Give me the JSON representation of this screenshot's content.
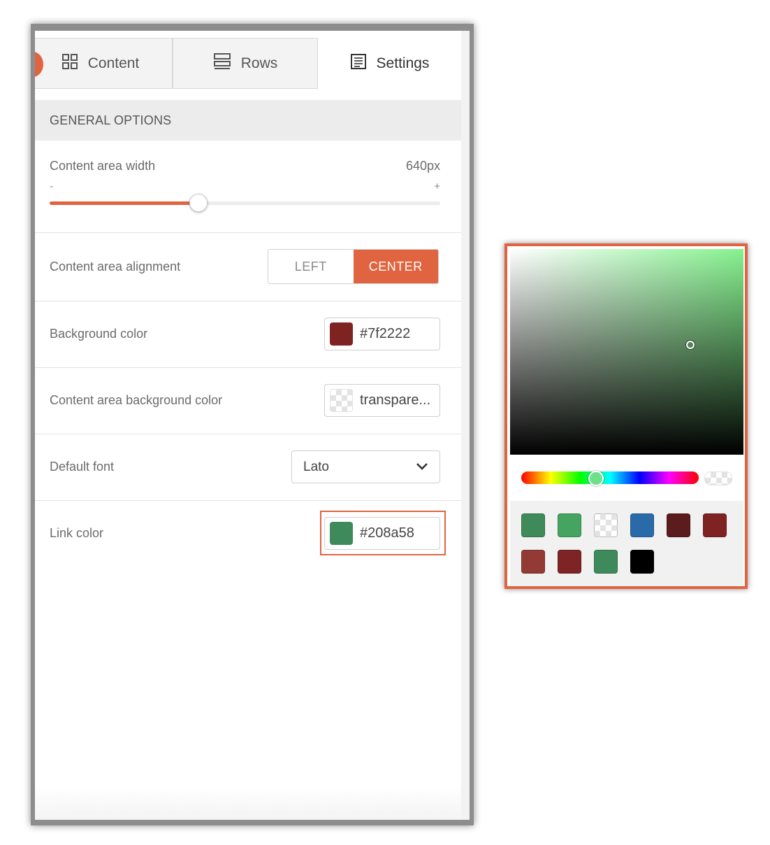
{
  "tabs": [
    {
      "label": "Content",
      "icon": "grid-icon"
    },
    {
      "label": "Rows",
      "icon": "rows-icon"
    },
    {
      "label": "Settings",
      "icon": "settings-doc-icon",
      "active": true
    }
  ],
  "section": {
    "title": "GENERAL OPTIONS"
  },
  "width_setting": {
    "label": "Content area width",
    "value": "640px",
    "min_label": "-",
    "max_label": "+",
    "slider_fraction": 0.38
  },
  "alignment": {
    "label": "Content area alignment",
    "options": [
      "LEFT",
      "CENTER"
    ],
    "selected": "CENTER"
  },
  "background_color": {
    "label": "Background color",
    "value": "#7f2222",
    "swatch": "#7f2222"
  },
  "content_bg_color": {
    "label": "Content area background color",
    "value": "transpare..."
  },
  "default_font": {
    "label": "Default font",
    "value": "Lato"
  },
  "link_color": {
    "label": "Link color",
    "value": "#208a58",
    "swatch": "#3f8a5b"
  },
  "picker": {
    "hue_color": "#86f28f",
    "hue_fraction": 0.42,
    "preset_swatches": [
      "#3f8a5b",
      "#46a461",
      "transparent",
      "#2b6aa8",
      "#5a1c1c",
      "#7f2222",
      "#943a34",
      "#7f2424",
      "#3f8a5b",
      "#000000"
    ]
  },
  "colors": {
    "accent": "#e0643f"
  }
}
